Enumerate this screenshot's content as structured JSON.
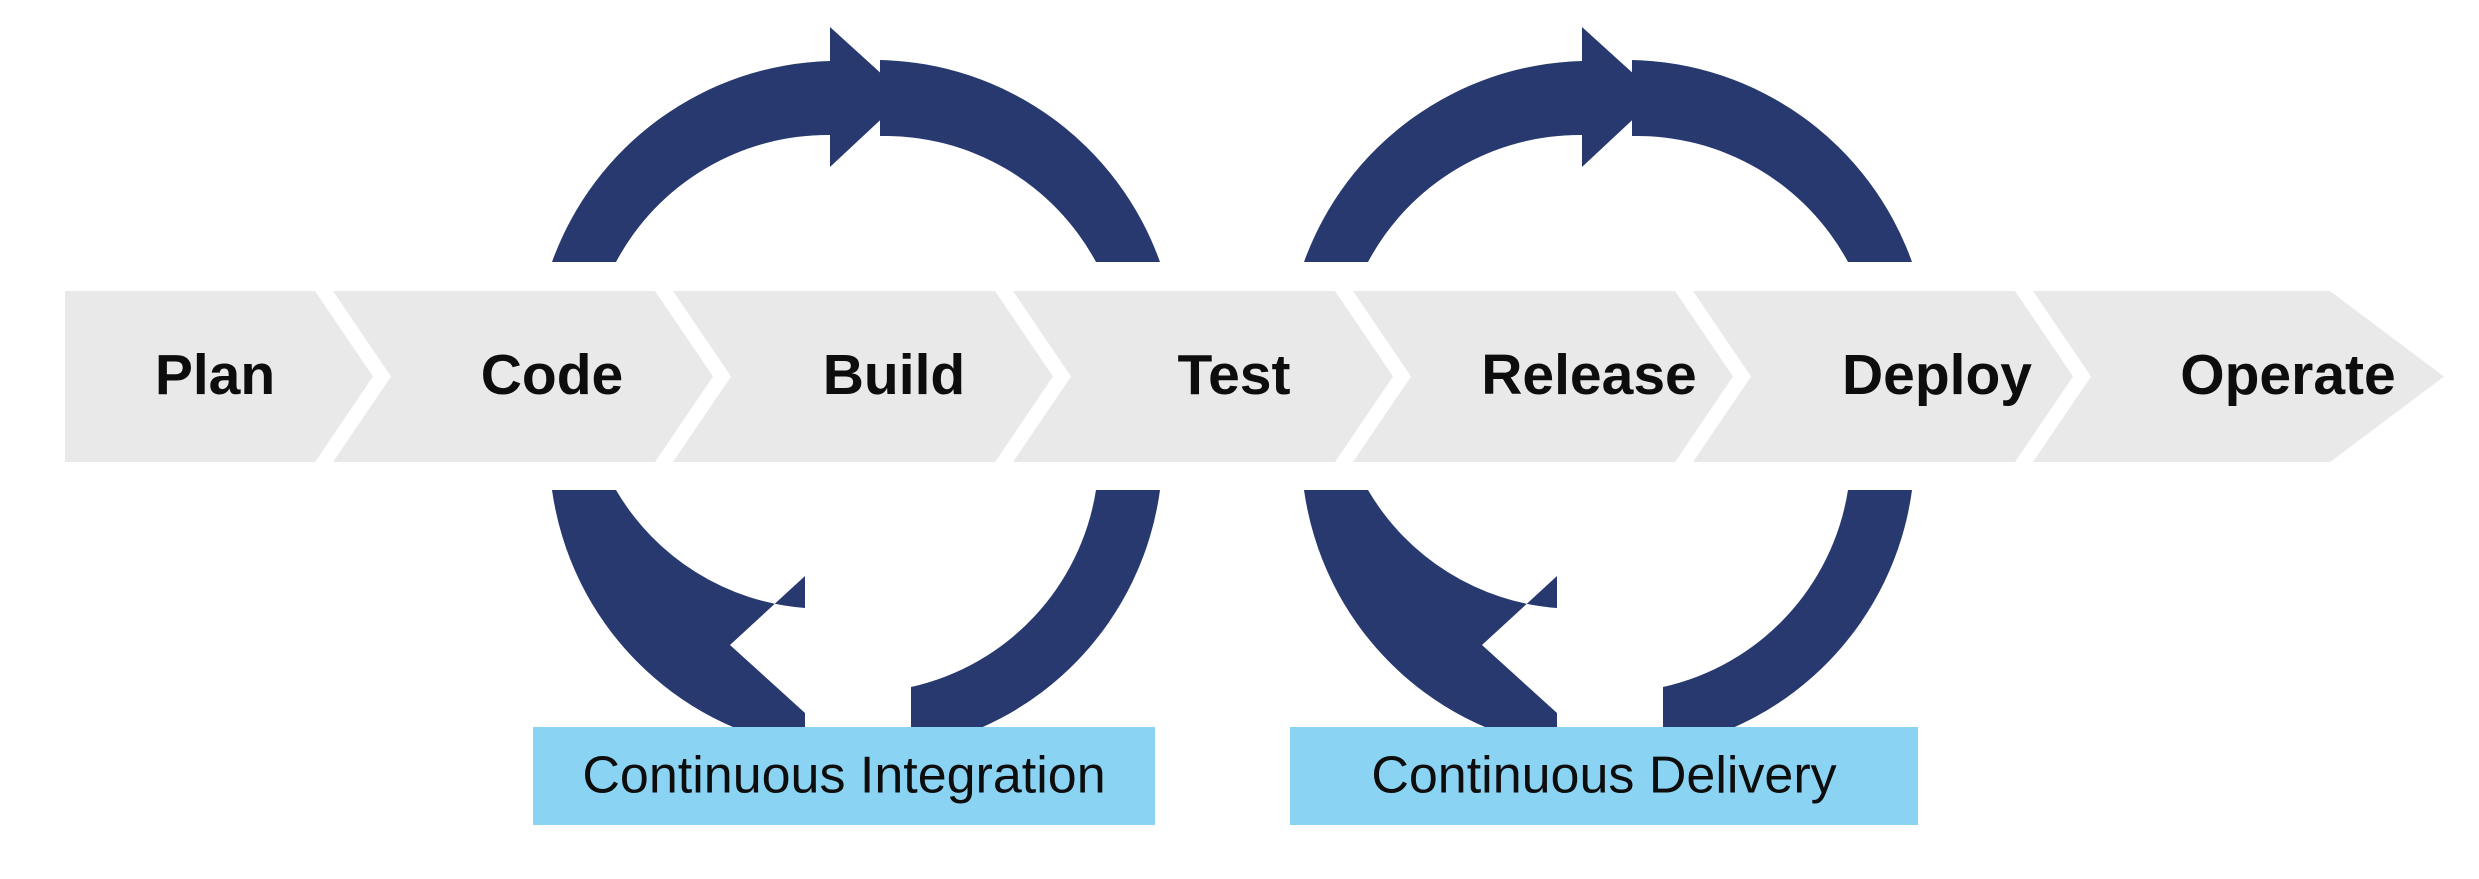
{
  "diagram": {
    "type": "devops-pipeline-loop",
    "background_color": "#ffffff",
    "pipeline": {
      "band_color": "#e9e9e9",
      "text_color": "#0d0d0d",
      "stages": [
        {
          "label": "Plan"
        },
        {
          "label": "Code"
        },
        {
          "label": "Build"
        },
        {
          "label": "Test"
        },
        {
          "label": "Release"
        },
        {
          "label": "Deploy"
        },
        {
          "label": "Operate"
        }
      ]
    },
    "loops": [
      {
        "name": "continuous-integration",
        "label": "Continuous Integration",
        "arc_color": "#28396f",
        "label_background": "#8bd3f2",
        "label_text_color": "#0d0d0d",
        "spans_stages": [
          "Code",
          "Build"
        ]
      },
      {
        "name": "continuous-delivery",
        "label": "Continuous Delivery",
        "arc_color": "#28396f",
        "label_background": "#8bd3f2",
        "label_text_color": "#0d0d0d",
        "spans_stages": [
          "Release",
          "Deploy"
        ]
      }
    ]
  }
}
